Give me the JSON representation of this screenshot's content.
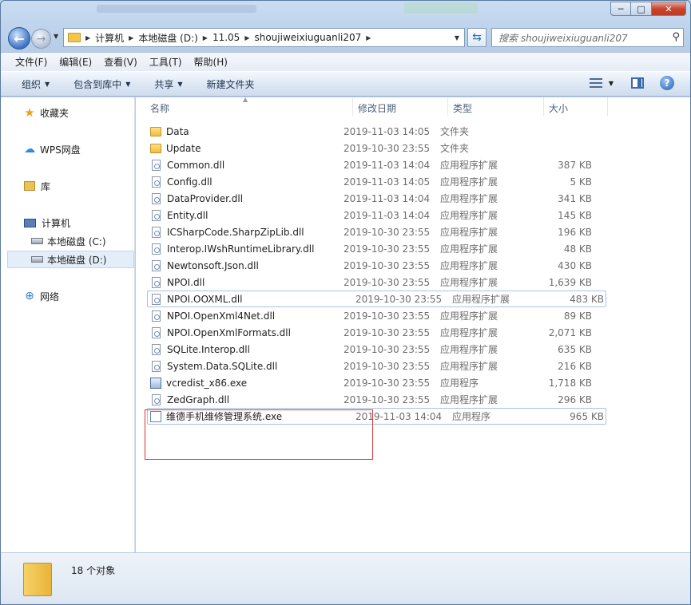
{
  "window": {
    "controls": {
      "minimize": "─",
      "maximize": "□",
      "close": "✕"
    }
  },
  "addressbar": {
    "back_glyph": "←",
    "forward_glyph": "→",
    "breadcrumbs": [
      "计算机",
      "本地磁盘 (D:)",
      "11.05",
      "shoujiweixiuguanli207"
    ],
    "refresh_glyph": "⇆"
  },
  "search": {
    "placeholder": "搜索 shoujiweixiuguanli207",
    "glyph": "⚲"
  },
  "menubar": {
    "items": [
      "文件(F)",
      "编辑(E)",
      "查看(V)",
      "工具(T)",
      "帮助(H)"
    ]
  },
  "commandbar": {
    "organize": "组织",
    "include_library": "包含到库中",
    "share": "共享",
    "new_folder": "新建文件夹",
    "help_glyph": "?"
  },
  "navpane": {
    "favorites": "收藏夹",
    "wps_drive": "WPS网盘",
    "library": "库",
    "computer": "计算机",
    "drive_c": "本地磁盘 (C:)",
    "drive_d": "本地磁盘 (D:)",
    "network": "网络"
  },
  "filelist": {
    "columns": {
      "name": "名称",
      "modified": "修改日期",
      "type": "类型",
      "size": "大小"
    },
    "rows": [
      {
        "name": "Data",
        "date": "2019-11-03 14:05",
        "type": "文件夹",
        "size": "",
        "icon": "folder-icon"
      },
      {
        "name": "Update",
        "date": "2019-10-30 23:55",
        "type": "文件夹",
        "size": "",
        "icon": "folder-icon"
      },
      {
        "name": "Common.dll",
        "date": "2019-11-03 14:04",
        "type": "应用程序扩展",
        "size": "387 KB",
        "icon": "dll-icon"
      },
      {
        "name": "Config.dll",
        "date": "2019-11-03 14:05",
        "type": "应用程序扩展",
        "size": "5 KB",
        "icon": "dll-icon"
      },
      {
        "name": "DataProvider.dll",
        "date": "2019-11-03 14:04",
        "type": "应用程序扩展",
        "size": "341 KB",
        "icon": "dll-icon"
      },
      {
        "name": "Entity.dll",
        "date": "2019-11-03 14:04",
        "type": "应用程序扩展",
        "size": "145 KB",
        "icon": "dll-icon"
      },
      {
        "name": "ICSharpCode.SharpZipLib.dll",
        "date": "2019-10-30 23:55",
        "type": "应用程序扩展",
        "size": "196 KB",
        "icon": "dll-icon"
      },
      {
        "name": "Interop.IWshRuntimeLibrary.dll",
        "date": "2019-10-30 23:55",
        "type": "应用程序扩展",
        "size": "48 KB",
        "icon": "dll-icon"
      },
      {
        "name": "Newtonsoft.Json.dll",
        "date": "2019-10-30 23:55",
        "type": "应用程序扩展",
        "size": "430 KB",
        "icon": "dll-icon"
      },
      {
        "name": "NPOI.dll",
        "date": "2019-10-30 23:55",
        "type": "应用程序扩展",
        "size": "1,639 KB",
        "icon": "dll-icon"
      },
      {
        "name": "NPOI.OOXML.dll",
        "date": "2019-10-30 23:55",
        "type": "应用程序扩展",
        "size": "483 KB",
        "icon": "dll-icon"
      },
      {
        "name": "NPOI.OpenXml4Net.dll",
        "date": "2019-10-30 23:55",
        "type": "应用程序扩展",
        "size": "89 KB",
        "icon": "dll-icon"
      },
      {
        "name": "NPOI.OpenXmlFormats.dll",
        "date": "2019-10-30 23:55",
        "type": "应用程序扩展",
        "size": "2,071 KB",
        "icon": "dll-icon"
      },
      {
        "name": "SQLite.Interop.dll",
        "date": "2019-10-30 23:55",
        "type": "应用程序扩展",
        "size": "635 KB",
        "icon": "dll-icon"
      },
      {
        "name": "System.Data.SQLite.dll",
        "date": "2019-10-30 23:55",
        "type": "应用程序扩展",
        "size": "216 KB",
        "icon": "dll-icon"
      },
      {
        "name": "vcredist_x86.exe",
        "date": "2019-10-30 23:55",
        "type": "应用程序",
        "size": "1,718 KB",
        "icon": "installer-icon"
      },
      {
        "name": "ZedGraph.dll",
        "date": "2019-10-30 23:55",
        "type": "应用程序扩展",
        "size": "296 KB",
        "icon": "dll-icon"
      },
      {
        "name": "维德手机维修管理系统.exe",
        "date": "2019-11-03 14:04",
        "type": "应用程序",
        "size": "965 KB",
        "icon": "app-icon"
      }
    ]
  },
  "statusbar": {
    "count": "18 个对象"
  }
}
